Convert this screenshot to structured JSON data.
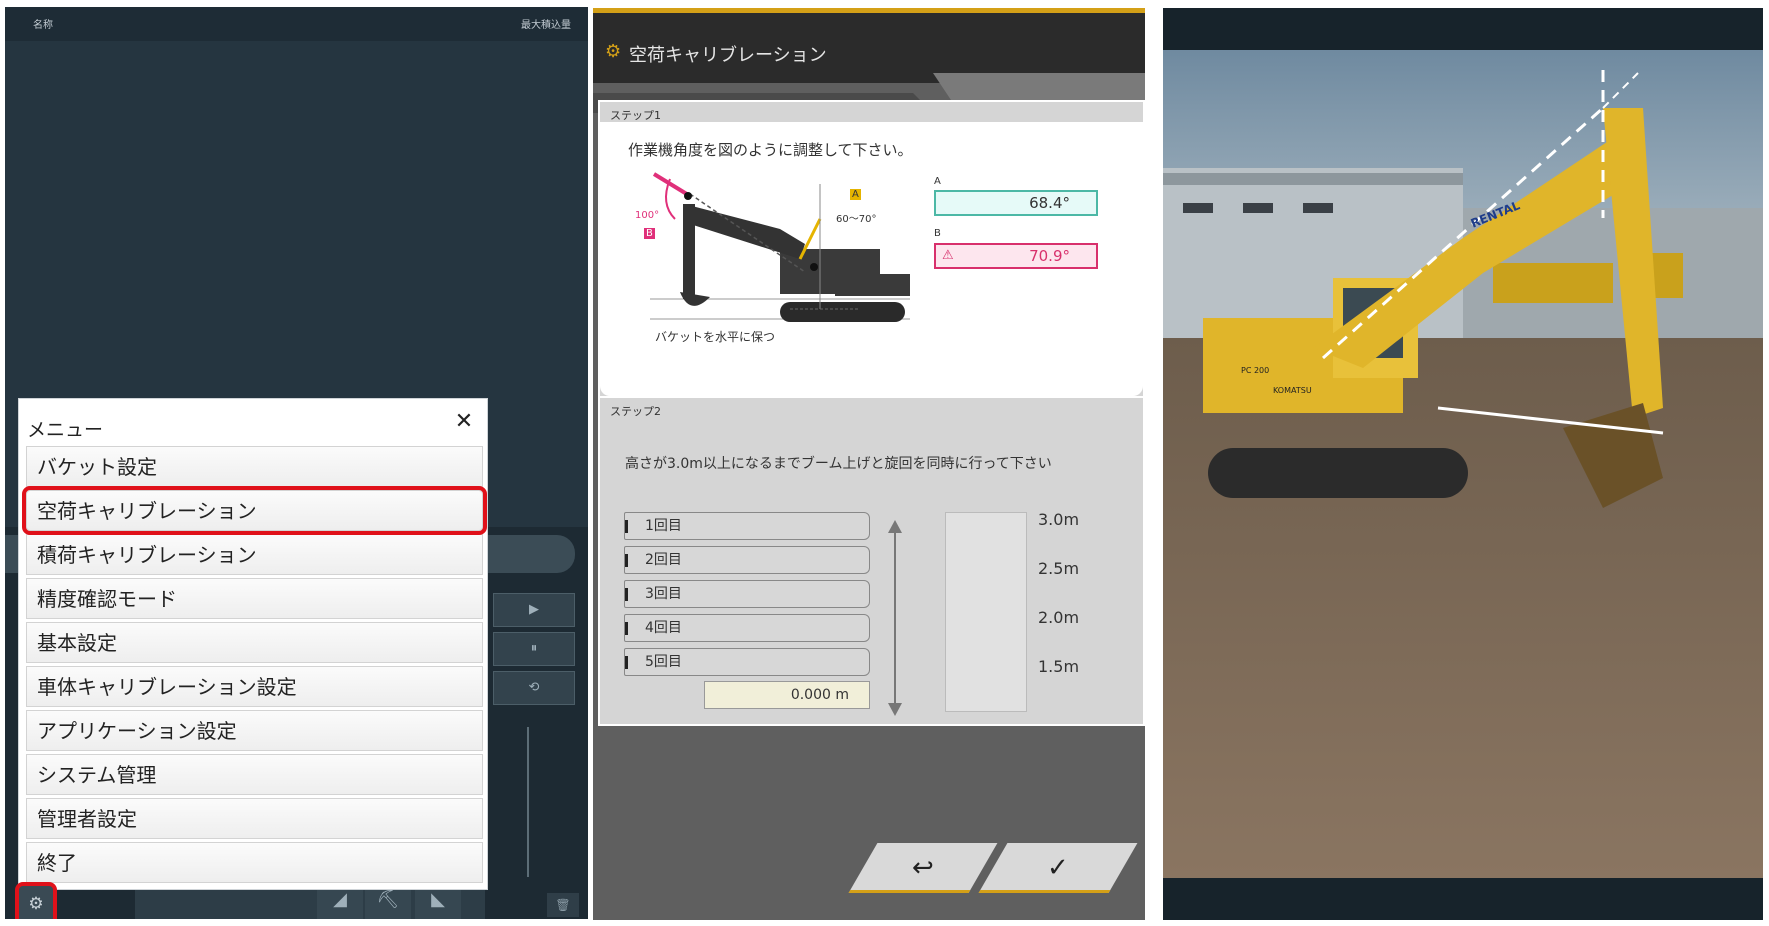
{
  "menu_screen": {
    "header": {
      "name_label": "名称",
      "max_load_label": "最大積込量"
    },
    "controls": {
      "play": "▶",
      "pause": "⏸",
      "reset": "⟲",
      "trash": "🗑"
    },
    "menu": {
      "title": "メニュー",
      "close": "✕",
      "items": [
        {
          "label": "バケット設定",
          "selected": false
        },
        {
          "label": "空荷キャリブレーション",
          "selected": true
        },
        {
          "label": "積荷キャリブレーション",
          "selected": false
        },
        {
          "label": "精度確認モード",
          "selected": false
        },
        {
          "label": "基本設定",
          "selected": false
        },
        {
          "label": "車体キャリブレーション設定",
          "selected": false
        },
        {
          "label": "アプリケーション設定",
          "selected": false
        },
        {
          "label": "システム管理",
          "selected": false
        },
        {
          "label": "管理者設定",
          "selected": false
        },
        {
          "label": "終了",
          "selected": false
        }
      ]
    },
    "gear_button": "⚙",
    "highlight_color": "#e0111a"
  },
  "calibration_screen": {
    "title": "空荷キャリブレーション",
    "title_icon": "gear-icon",
    "step1": {
      "label": "ステップ1",
      "instruction": "作業機角度を図のように調整して下さい。",
      "diagram": {
        "angle_b": "100°",
        "marker_b": "B",
        "marker_a": "A",
        "angle_range_a": "60～70°",
        "caption": "バケットを水平に保つ"
      },
      "field_a": {
        "label": "A",
        "value": "68.4°"
      },
      "field_b": {
        "label": "B",
        "value": "70.9°",
        "warning_icon": "⚠"
      }
    },
    "step2": {
      "label": "ステップ2",
      "instruction": "高さが3.0m以上になるまでブーム上げと旋回を同時に行って下さい",
      "tries": [
        "1回目",
        "2回目",
        "3回目",
        "4回目",
        "5回目"
      ],
      "height_value": "0.000 m",
      "scale": [
        "3.0m",
        "2.5m",
        "2.0m",
        "1.5m"
      ]
    },
    "nav": {
      "back": "↩",
      "confirm": "✓"
    },
    "accent": "#d4a017"
  },
  "photo": {
    "description_icon": "excavator-photo",
    "boom_brand": "RENTAL",
    "model_label": "PC 200",
    "maker_label": "KOMATSU"
  }
}
